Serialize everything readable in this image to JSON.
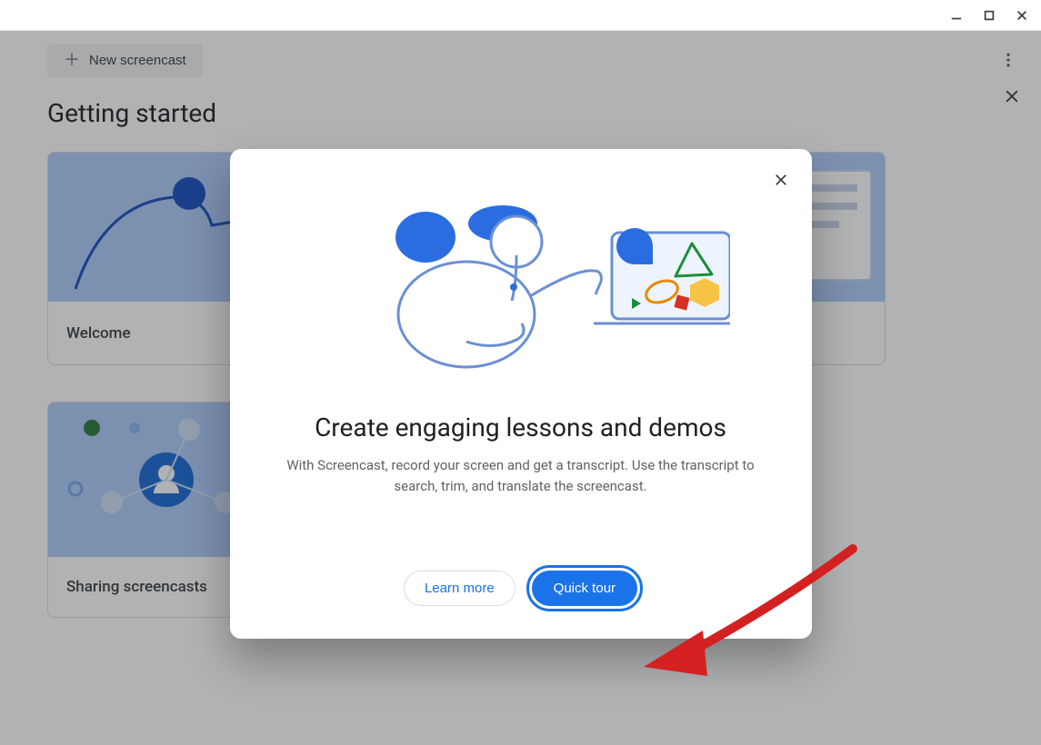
{
  "window": {
    "title": ""
  },
  "toolbar": {
    "new_label": "New screencast"
  },
  "section": {
    "title": "Getting started"
  },
  "cards": [
    {
      "title": "Welcome"
    },
    {
      "title": "Sharing screencasts"
    }
  ],
  "modal": {
    "heading": "Create engaging lessons and demos",
    "body": "With Screencast, record your screen and get a transcript. Use the transcript to search, trim, and translate the screencast.",
    "learn_more": "Learn more",
    "quick_tour": "Quick tour"
  }
}
